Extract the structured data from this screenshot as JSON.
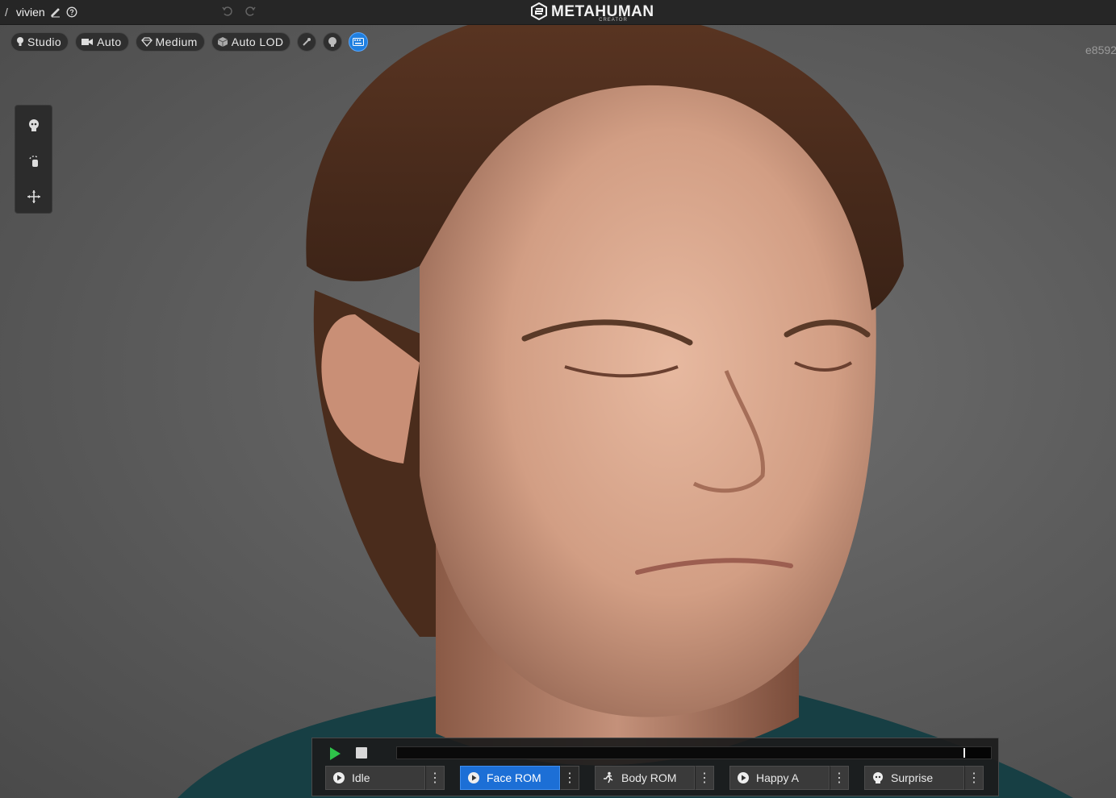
{
  "titlebar": {
    "project_slash": "/",
    "project_name": "vivien",
    "logo_text": "METAHUMAN",
    "logo_sub": "CREATOR"
  },
  "toolbar": {
    "lighting": "Studio",
    "camera": "Auto",
    "quality": "Medium",
    "lod": "Auto LOD"
  },
  "viewer_id": "e8592",
  "playback": {
    "progress": 0.955,
    "animations": [
      {
        "label": "Idle",
        "icon": "play-circle-icon",
        "selected": false
      },
      {
        "label": "Face ROM",
        "icon": "play-circle-icon",
        "selected": true
      },
      {
        "label": "Body ROM",
        "icon": "running-figure-icon",
        "selected": false
      },
      {
        "label": "Happy A",
        "icon": "play-circle-icon",
        "selected": false
      },
      {
        "label": "Surprise",
        "icon": "head-icon",
        "selected": false
      }
    ],
    "more_glyph": "⋮"
  },
  "colors": {
    "accent": "#1c6fd6",
    "play": "#2ec44a",
    "titlebar": "#262626"
  }
}
